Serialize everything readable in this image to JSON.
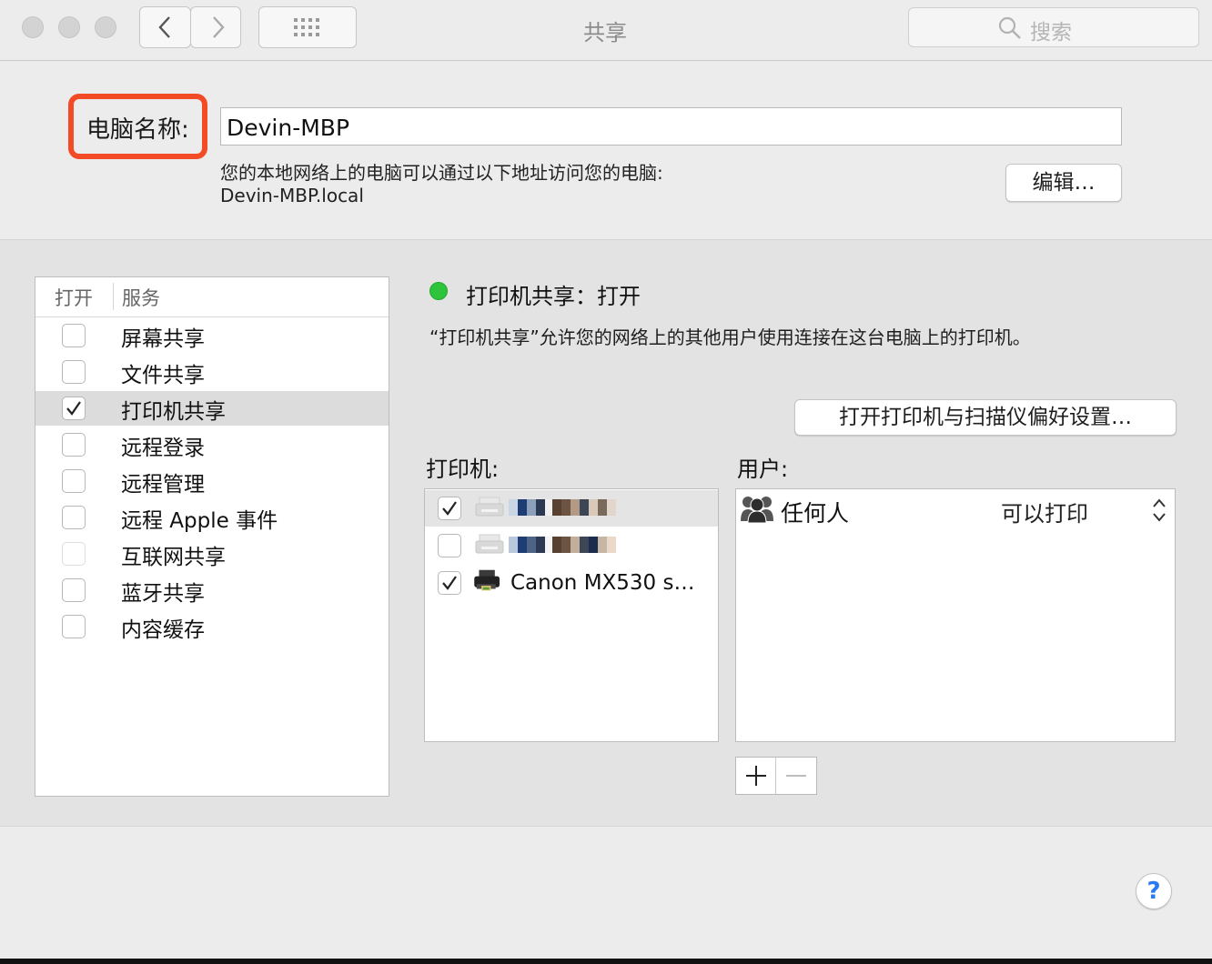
{
  "window": {
    "title": "共享"
  },
  "toolbar": {
    "back_icon": "chevron-left-icon",
    "forward_icon": "chevron-right-icon",
    "grid_icon": "grid-icon",
    "search_placeholder": "搜索"
  },
  "computer_name": {
    "label": "电脑名称:",
    "value": "Devin-MBP",
    "address_description": "您的本地网络上的电脑可以通过以下地址访问您的电脑:",
    "address": "Devin-MBP.local",
    "edit_button": "编辑…",
    "highlight_color": "#f34b25"
  },
  "services": {
    "header_open": "打开",
    "header_service": "服务",
    "items": [
      {
        "label": "屏幕共享",
        "checked": false,
        "selected": false
      },
      {
        "label": "文件共享",
        "checked": false,
        "selected": false
      },
      {
        "label": "打印机共享",
        "checked": true,
        "selected": true
      },
      {
        "label": "远程登录",
        "checked": false,
        "selected": false
      },
      {
        "label": "远程管理",
        "checked": false,
        "selected": false
      },
      {
        "label": "远程 Apple 事件",
        "checked": false,
        "selected": false
      },
      {
        "label": "互联网共享",
        "checked": false,
        "selected": false,
        "disabled": true
      },
      {
        "label": "蓝牙共享",
        "checked": false,
        "selected": false
      },
      {
        "label": "内容缓存",
        "checked": false,
        "selected": false
      }
    ]
  },
  "status": {
    "text": "打印机共享：打开",
    "color": "#2dc43b",
    "description": "“打印机共享”允许您的网络上的其他用户使用连接在这台电脑上的打印机。"
  },
  "printer_prefs_button": "打开打印机与扫描仪偏好设置…",
  "printers": {
    "label": "打印机:",
    "items": [
      {
        "name": "",
        "checked": true,
        "selected": true,
        "obscured": true
      },
      {
        "name": "",
        "checked": false,
        "selected": false,
        "obscured": true
      },
      {
        "name": "Canon MX530 s…",
        "checked": true,
        "selected": false,
        "obscured": false
      }
    ]
  },
  "users": {
    "label": "用户:",
    "items": [
      {
        "name": "任何人",
        "permission": "可以打印",
        "icon": "group-icon"
      }
    ]
  },
  "help_button": "?"
}
